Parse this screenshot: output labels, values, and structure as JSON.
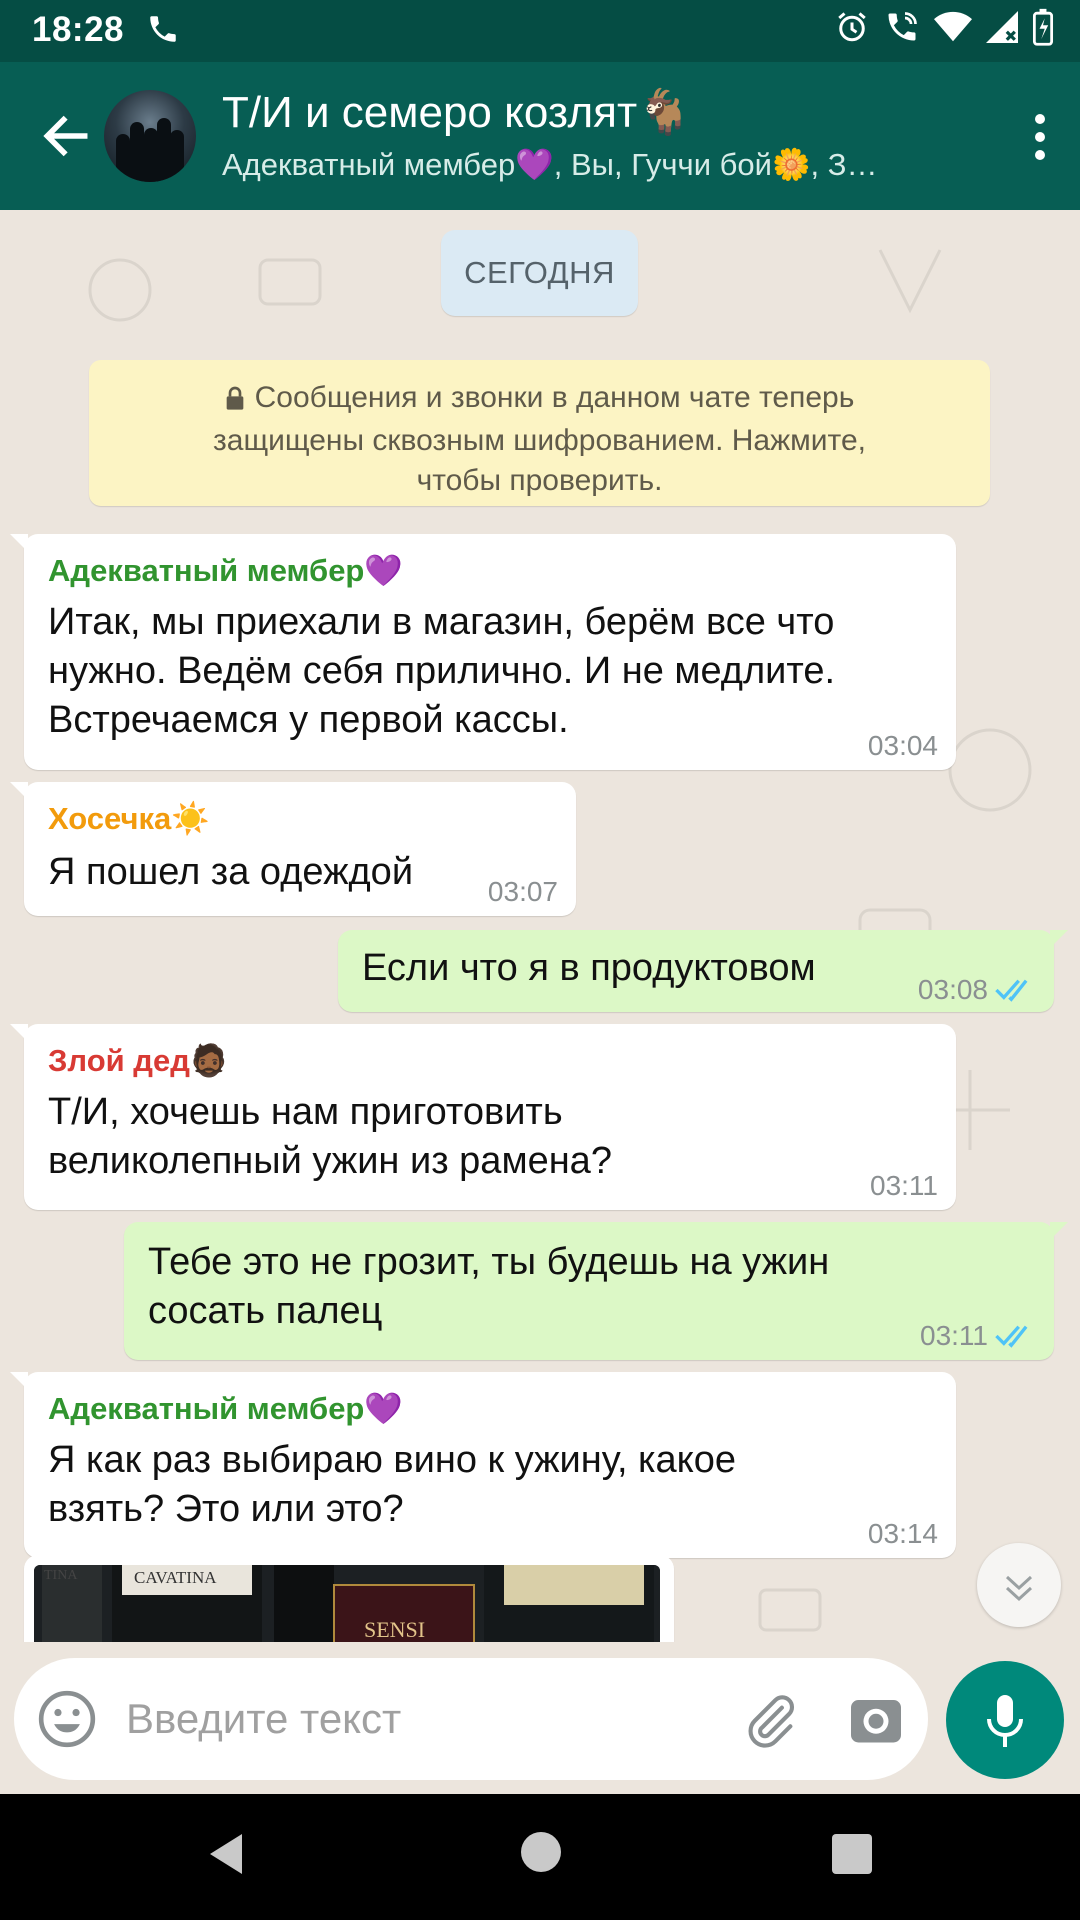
{
  "status": {
    "time": "18:28"
  },
  "header": {
    "title": "Т/И и семеро козлят🐐",
    "subtitle": "Адекватный мембер💜, Вы, Гуччи бой🌼, З…"
  },
  "chat": {
    "date_chip": "СЕГОДНЯ",
    "e2e_notice_lines": [
      "Сообщения и звонки в данном чате теперь",
      "защищены сквозным шифрованием. Нажмите,",
      "чтобы проверить."
    ],
    "messages": [
      {
        "sender": "Адекватный мембер💜",
        "sender_color": "#31942f",
        "lines": [
          "Итак, мы приехали в магазин, берём все что",
          "нужно. Ведём себя прилично. И не медлите.",
          "Встречаемся у первой кассы."
        ],
        "time": "03:04"
      },
      {
        "sender": "Хосечка☀️",
        "sender_color": "#f29b0c",
        "lines": [
          "Я пошел за одеждой"
        ],
        "time": "03:07"
      },
      {
        "lines": [
          "Если что я в продуктовом"
        ],
        "time": "03:08"
      },
      {
        "sender": "Злой дед🧔🏾",
        "sender_color": "#d83a34",
        "lines": [
          "Т/И, хочешь нам приготовить",
          "великолепный ужин из рамена?"
        ],
        "time": "03:11"
      },
      {
        "lines": [
          "Тебе это не грозит, ты будешь на ужин",
          "сосать палец"
        ],
        "time": "03:11"
      },
      {
        "sender": "Адекватный мембер💜",
        "sender_color": "#31942f",
        "lines": [
          "Я как раз выбираю вино к ужину, какое",
          "взять? Это или это?"
        ],
        "time": "03:14"
      }
    ],
    "photo_labels": [
      "TINA",
      "CAVATINA",
      "SENSI"
    ]
  },
  "input": {
    "placeholder": "Введите текст"
  },
  "colors": {
    "header": "#075e54",
    "statusbar": "#054d44",
    "incoming": "#ffffff",
    "outgoing": "#dcf8c6",
    "read_ticks": "#4fc3f7",
    "mic": "#00897b"
  }
}
